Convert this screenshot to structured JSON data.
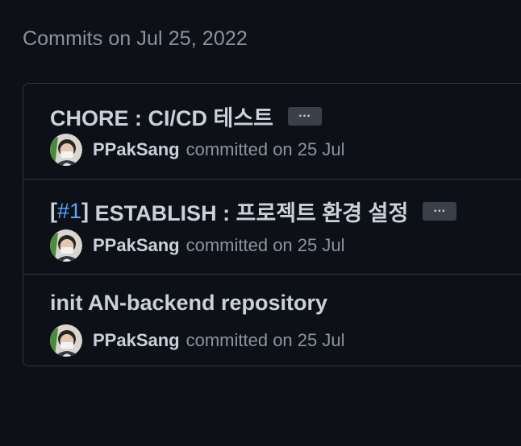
{
  "date_heading": "Commits on Jul 25, 2022",
  "commits": [
    {
      "title": "CHORE : CI/CD 테스트",
      "author": "PPakSang",
      "committed_text": "committed on 25 Jul",
      "ellipsis_label": "…"
    },
    {
      "title_prefix_open": "[",
      "issue_ref": "#1",
      "title_prefix_close": "]",
      "title": "ESTABLISH : 프로젝트 환경 설정",
      "author": "PPakSang",
      "committed_text": "committed on 25 Jul",
      "ellipsis_label": "…"
    },
    {
      "title": "init AN-backend repository",
      "author": "PPakSang",
      "committed_text": "committed on 25 Jul"
    }
  ],
  "colors": {
    "background": "#0d1117",
    "border": "#30363d",
    "text": "#c9d1d9",
    "muted": "#8b949e",
    "link": "#58a6ff"
  },
  "icons": {
    "avatar": "user-avatar-photo",
    "ellipsis": "ellipsis-expand-icon"
  }
}
